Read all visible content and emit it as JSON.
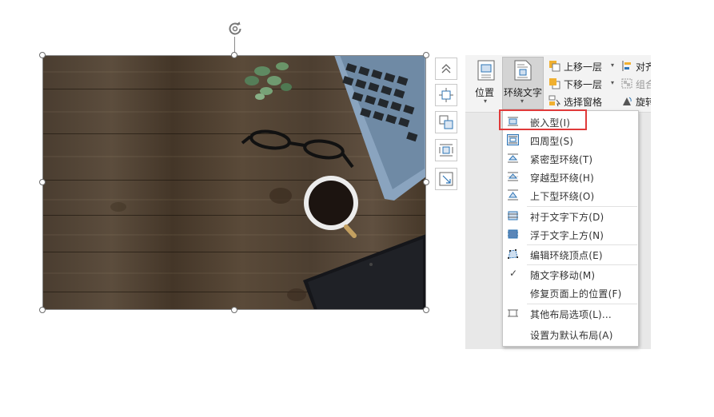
{
  "ribbon": {
    "position_label": "位置",
    "wrap_text_label": "环绕文字",
    "bring_forward_label": "上移一层",
    "send_backward_label": "下移一层",
    "selection_pane_label": "选择窗格",
    "align_label": "对齐",
    "group_label": "组合",
    "rotate_label": "旋转"
  },
  "side_buttons": [
    {
      "icon": "collapse-up-icon"
    },
    {
      "icon": "layout-options-icon"
    },
    {
      "icon": "bring-to-front-icon"
    },
    {
      "icon": "wrap-text-icon"
    },
    {
      "icon": "resize-icon"
    }
  ],
  "wrap_menu": {
    "items": [
      {
        "label": "嵌入型(I)",
        "icon": "inline-icon",
        "highlighted": true
      },
      {
        "label": "四周型(S)",
        "icon": "square-wrap-icon"
      },
      {
        "label": "紧密型环绕(T)",
        "icon": "tight-wrap-icon"
      },
      {
        "label": "穿越型环绕(H)",
        "icon": "through-wrap-icon"
      },
      {
        "label": "上下型环绕(O)",
        "icon": "top-bottom-wrap-icon"
      },
      {
        "label": "衬于文字下方(D)",
        "icon": "behind-text-icon"
      },
      {
        "label": "浮于文字上方(N)",
        "icon": "in-front-text-icon"
      },
      {
        "label": "编辑环绕顶点(E)",
        "icon": "edit-wrap-points-icon"
      },
      {
        "label": "随文字移动(M)",
        "icon": "check-icon",
        "checked": true
      },
      {
        "label": "修复页面上的位置(F)",
        "icon": ""
      },
      {
        "label": "其他布局选项(L)...",
        "icon": "more-layout-icon"
      },
      {
        "label": "设置为默认布局(A)",
        "icon": ""
      }
    ]
  }
}
